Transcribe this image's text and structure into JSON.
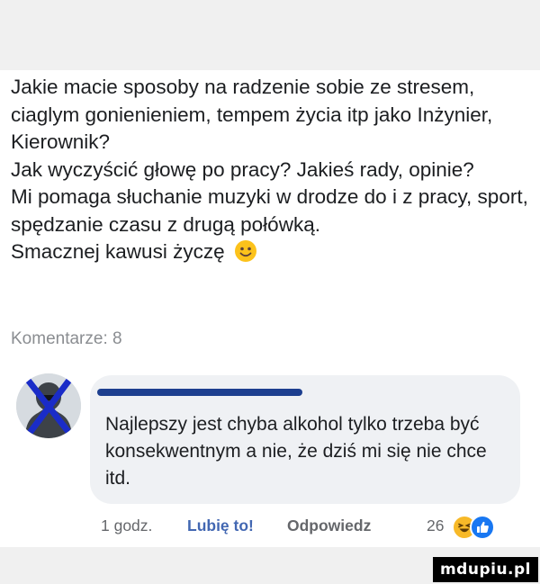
{
  "post": {
    "lines": [
      "Jakie macie sposoby na radzenie sobie ze stresem, ciaglym gonienieniem, tempem życia itp jako Inżynier, Kierownik?",
      "Jak wyczyścić głowę po pracy? Jakieś rady, opinie?",
      "Mi pomaga słuchanie muzyki w drodze do i z pracy, sport, spędzanie czasu z drugą połówką.",
      "Smacznej kawusi życzę"
    ],
    "emoji": "smiling-face-emoji"
  },
  "comments_label": "Komentarze: 8",
  "comment": {
    "text": "Najlepszy jest chyba alkohol tylko trzeba być konsekwentnym a nie, że dziś mi się nie chce itd.",
    "time": "1 godz.",
    "like_label": "Lubię to!",
    "reply_label": "Odpowiedz",
    "reactions_count": "26",
    "reactions": [
      "haha-reaction-icon",
      "like-reaction-icon"
    ]
  },
  "watermark": "mdupiu.pl",
  "colors": {
    "link_blue": "#4267b2",
    "bubble_bg": "#eff1f4",
    "meta_gray": "#65676b",
    "censor_blue": "#1d3f8f"
  }
}
